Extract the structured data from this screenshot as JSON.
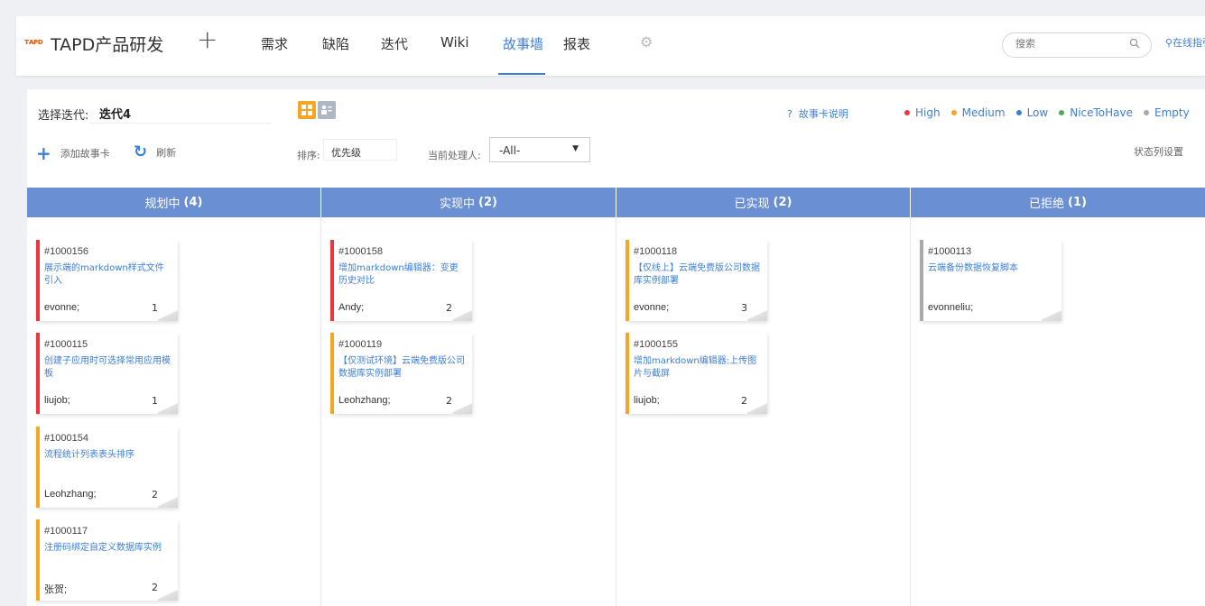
{
  "app": {
    "logo_text": "ⓉⓁⓅ",
    "title": "TAPD产品研发",
    "add_label": "+"
  },
  "nav": {
    "items": [
      {
        "label": "需求"
      },
      {
        "label": "缺陷"
      },
      {
        "label": "迭代"
      },
      {
        "label": "Wiki"
      },
      {
        "label": "故事墙",
        "active": true
      },
      {
        "label": "报表"
      }
    ],
    "search_placeholder": "搜索",
    "guide_label": "在线指引"
  },
  "filter": {
    "iteration_label": "选择迭代:",
    "iteration_value": "迭代4",
    "help_label": "故事卡说明",
    "legend": [
      {
        "label": "High",
        "color": "#e8373e"
      },
      {
        "label": "Medium",
        "color": "#f5a623"
      },
      {
        "label": "Low",
        "color": "#3c7fd6"
      },
      {
        "label": "NiceToHave",
        "color": "#4caf50"
      },
      {
        "label": "Empty",
        "color": "#aaaaaa"
      }
    ],
    "add_card_label": "添加故事卡",
    "refresh_label": "刷新",
    "sort_label": "排序:",
    "sort_value": "优先级",
    "handler_label": "当前处理人:",
    "handler_value": "-All-",
    "column_settings_label": "状态列设置"
  },
  "columns": [
    {
      "name": "规划中",
      "count": "(4)",
      "cards": [
        {
          "id": "#1000156",
          "title": "展示端的markdown样式文件引入",
          "owner": "evonne;",
          "points": "1",
          "priority_color": "#e8373e"
        },
        {
          "id": "#1000115",
          "title": "创建子应用时可选择常用应用模板",
          "owner": "liujob;",
          "points": "1",
          "priority_color": "#e8373e"
        },
        {
          "id": "#1000154",
          "title": "流程统计列表表头排序",
          "owner": "Leohzhang;",
          "points": "2",
          "priority_color": "#f5a623"
        },
        {
          "id": "#1000117",
          "title": "注册码绑定自定义数据库实例",
          "owner": "张贺;",
          "points": "2",
          "priority_color": "#f5a623"
        }
      ]
    },
    {
      "name": "实现中",
      "count": "(2)",
      "cards": [
        {
          "id": "#1000158",
          "title": "增加markdown编辑器：变更历史对比",
          "owner": "Andy;",
          "points": "2",
          "priority_color": "#e8373e"
        },
        {
          "id": "#1000119",
          "title": "【仅测试环境】云端免费版公司数据库实例部署",
          "owner": "Leohzhang;",
          "points": "2",
          "priority_color": "#f5a623"
        }
      ]
    },
    {
      "name": "已实现",
      "count": "(2)",
      "cards": [
        {
          "id": "#1000118",
          "title": "【仅线上】云端免费版公司数据库实例部署",
          "owner": "evonne;",
          "points": "3",
          "priority_color": "#f5a623"
        },
        {
          "id": "#1000155",
          "title": "增加markdown编辑器:上传图片与截屏",
          "owner": "liujob;",
          "points": "2",
          "priority_color": "#f5a623"
        }
      ]
    },
    {
      "name": "已拒绝",
      "count": "(1)",
      "cards": [
        {
          "id": "#1000113",
          "title": "云端备份数据恢复脚本",
          "owner": "evonneliu;",
          "points": "",
          "priority_color": "#aaaaaa"
        }
      ]
    }
  ]
}
